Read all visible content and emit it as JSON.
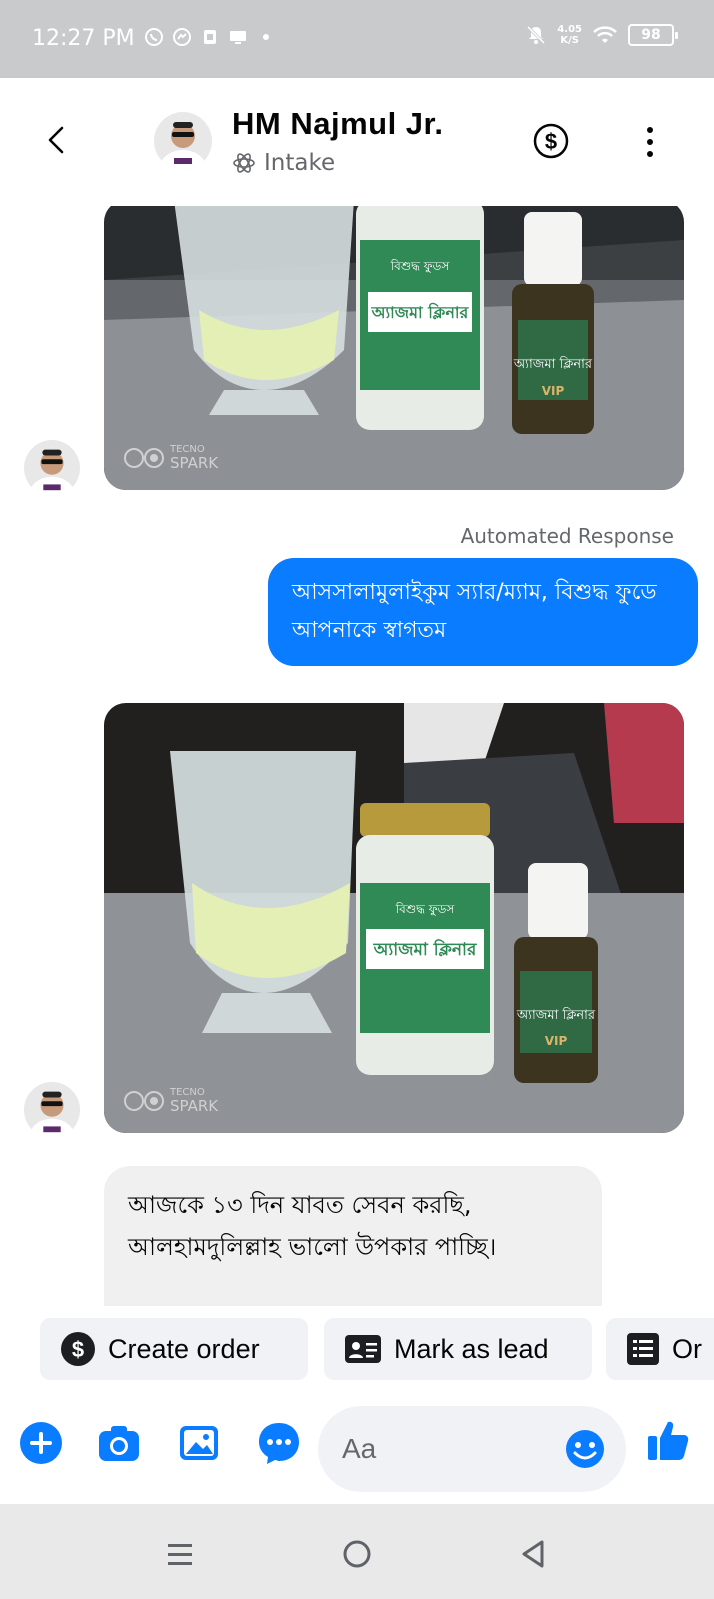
{
  "status_bar": {
    "time": "12:27 PM",
    "net_speed_value": "4.05",
    "net_speed_unit": "K/S",
    "battery": "98"
  },
  "header": {
    "contact_name": "HM Najmul Jr.",
    "label": "Intake"
  },
  "messages": {
    "automated_label": "Automated Response",
    "outgoing_text": "আসসালামুলাইকুম স্যার/ম্যাম, বিশুদ্ধ ফুডে আপনাকে স্বাগতম",
    "incoming_text": "আজকে ১৩ দিন যাবত সেবন করছি, আলহামদুলিল্লাহ ভালো উপকার পাচ্ছি।",
    "photo_watermark_brand": "TECNO",
    "photo_watermark_model": "SPARK",
    "product_brand": "বিশুদ্ধ ফুডস",
    "product_name": "অ্যাজমা ক্লিনার",
    "product_badge": "VIP"
  },
  "quick_actions": [
    {
      "label": "Create order"
    },
    {
      "label": "Mark as lead"
    },
    {
      "label": "Or"
    }
  ],
  "composer": {
    "placeholder": "Aa"
  },
  "colors": {
    "accent": "#0a7cff",
    "status_bar_bg": "#c9cacc",
    "incoming_bubble": "#f0f0f0",
    "chip_bg": "#f0f2f5"
  }
}
